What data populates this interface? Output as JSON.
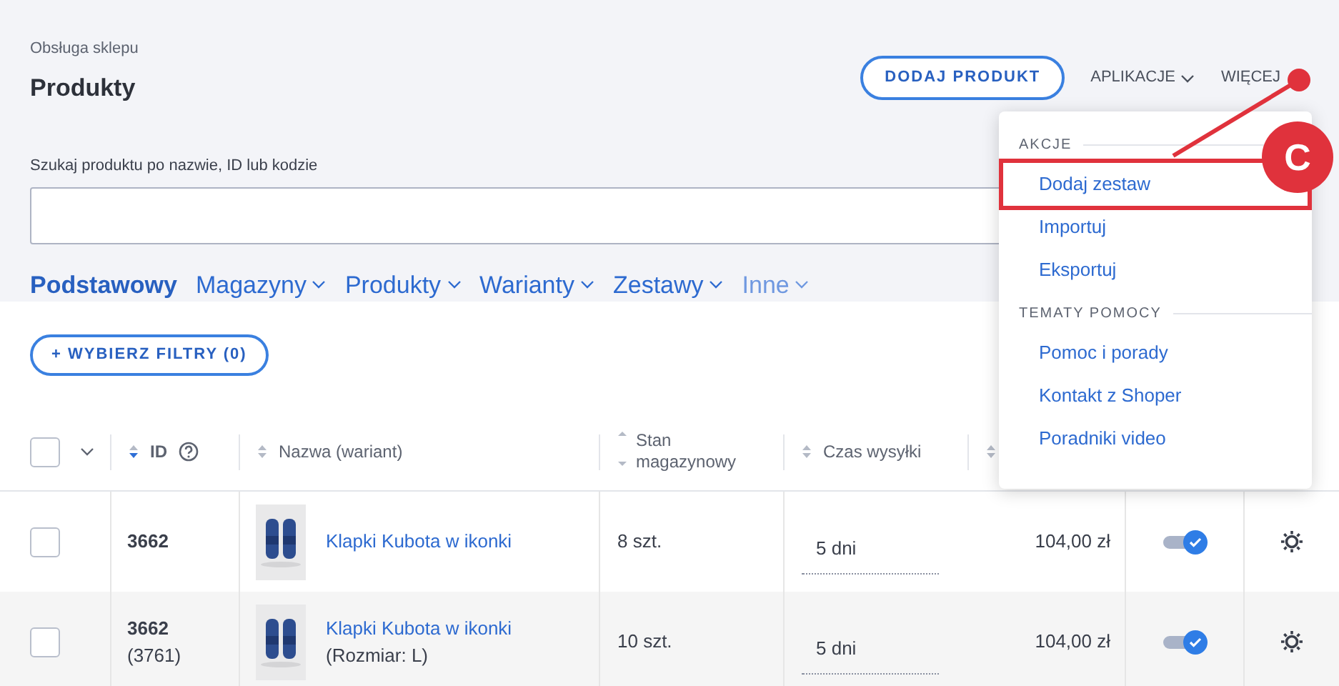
{
  "header": {
    "breadcrumb": "Obsługa sklepu",
    "title": "Produkty",
    "add_button": "DODAJ PRODUKT",
    "menus": [
      {
        "label": "APLIKACJE",
        "caret": true
      },
      {
        "label": "WIĘCEJ",
        "caret": false
      }
    ]
  },
  "search": {
    "label": "Szukaj produktu po nazwie, ID lub kodzie"
  },
  "tabs": [
    {
      "label": "Podstawowy",
      "selected": true,
      "caret": false,
      "muted": false
    },
    {
      "label": "Magazyny",
      "selected": false,
      "caret": true,
      "muted": false
    },
    {
      "label": "Produkty",
      "selected": false,
      "caret": true,
      "muted": false
    },
    {
      "label": "Warianty",
      "selected": false,
      "caret": true,
      "muted": false
    },
    {
      "label": "Zestawy",
      "selected": false,
      "caret": true,
      "muted": false
    },
    {
      "label": "Inne",
      "selected": false,
      "caret": true,
      "muted": true
    }
  ],
  "filter_button": "+ WYBIERZ FILTRY (0)",
  "table": {
    "select_all": {
      "checked": false
    },
    "columns": [
      {
        "kind": "help",
        "label": "ID",
        "sorted": true
      },
      {
        "kind": "plain",
        "label": "Nazwa (wariant)",
        "sorted": false
      },
      {
        "kind": "split",
        "label": "Stan magazynowy",
        "sorted": false
      },
      {
        "kind": "plain",
        "label": "Czas wysyłki",
        "sorted": false
      },
      {
        "kind": "plain",
        "sorted": false
      }
    ],
    "rows": [
      {
        "checked": false,
        "id": "3662",
        "name": "Klapki Kubota w ikonki",
        "stock": "8 szt.",
        "shipping": "5 dni",
        "price": "104,00 zł",
        "on": true
      },
      {
        "checked": false,
        "id": "3662",
        "variant_id": "(3761)",
        "name": "Klapki Kubota w ikonki",
        "variant": "(Rozmiar: L)",
        "stock": "10 szt.",
        "shipping": "5 dni",
        "price": "104,00 zł",
        "on": true
      }
    ]
  },
  "dropdown": {
    "sections": [
      {
        "title": "AKCJE",
        "items": [
          {
            "label": "Dodaj zestaw",
            "highlighted": true
          },
          {
            "label": "Importuj",
            "highlighted": false
          },
          {
            "label": "Eksportuj",
            "highlighted": false
          }
        ]
      },
      {
        "title": "TEMATY POMOCY",
        "items": [
          {
            "label": "Pomoc i porady",
            "highlighted": false
          },
          {
            "label": "Kontakt z Shoper",
            "highlighted": false
          },
          {
            "label": "Poradniki video",
            "highlighted": false
          }
        ]
      }
    ]
  },
  "annotation": {
    "label": "C"
  }
}
